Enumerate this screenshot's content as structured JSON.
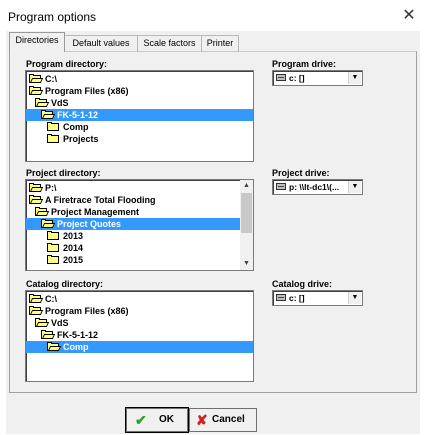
{
  "window": {
    "title": "Program options",
    "close_glyph": "✕"
  },
  "tabs": [
    {
      "label": "Directories",
      "active": true
    },
    {
      "label": "Default values",
      "active": false
    },
    {
      "label": "Scale factors",
      "active": false
    },
    {
      "label": "Printer",
      "active": false
    }
  ],
  "program": {
    "dir_label": "Program directory:",
    "items": [
      "C:\\",
      "Program Files (x86)",
      "VdS",
      "FK-5-1-12",
      "Comp",
      "Projects"
    ],
    "selected_index": 3,
    "drive_label": "Program drive:",
    "drive_value": "c: []"
  },
  "project": {
    "dir_label": "Project directory:",
    "items": [
      "P:\\",
      "A Firetrace Total Flooding",
      "Project Management",
      "Project Quotes",
      "2013",
      "2014",
      "2015"
    ],
    "selected_index": 3,
    "drive_label": "Project drive:",
    "drive_value": "p: \\\\lt-dc1\\(..."
  },
  "catalog": {
    "dir_label": "Catalog directory:",
    "items": [
      "C:\\",
      "Program Files (x86)",
      "VdS",
      "FK-5-1-12",
      "Comp"
    ],
    "selected_index": 4,
    "drive_label": "Catalog drive:",
    "drive_value": "c: []"
  },
  "buttons": {
    "ok": "OK",
    "cancel": "Cancel"
  },
  "icons": {
    "ok": "check-icon",
    "cancel": "x-icon",
    "folder": "folder-icon",
    "drive": "drive-icon"
  },
  "colors": {
    "selection": "#3399ff",
    "ok_check": "#2e9e2e",
    "cancel_x": "#d22020"
  }
}
